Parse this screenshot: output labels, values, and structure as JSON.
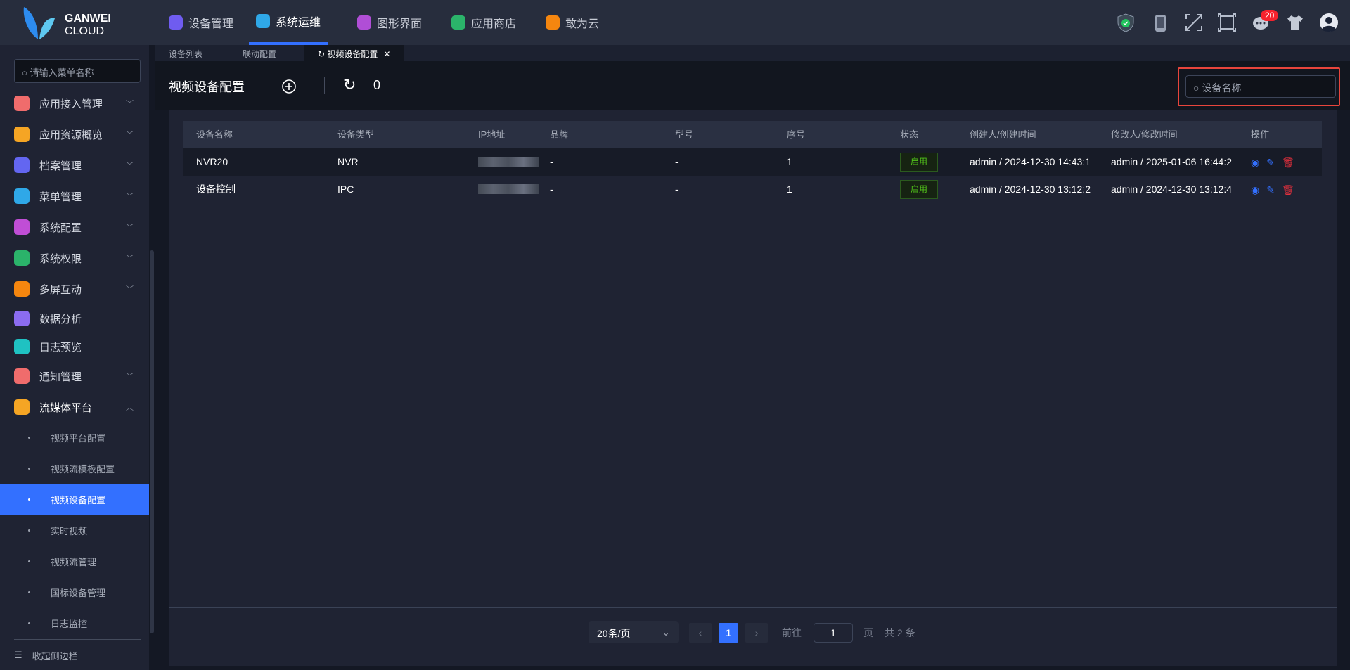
{
  "brand": {
    "line1": "GANWEI",
    "line2": "CLOUD"
  },
  "nav": [
    {
      "label": "设备管理",
      "color": "#6f5cf0"
    },
    {
      "label": "系统运维",
      "color": "#2fa8e8",
      "active": true
    },
    {
      "label": "图形界面",
      "color": "#b04ed6"
    },
    {
      "label": "应用商店",
      "color": "#2bb36a"
    },
    {
      "label": "敢为云",
      "color": "#f5860f"
    }
  ],
  "top_icons": {
    "badge": "20"
  },
  "sidebar": {
    "search_placeholder": "请输入菜单名称",
    "items": [
      {
        "label": "应用接入管理",
        "color": "#f06c6c"
      },
      {
        "label": "应用资源概览",
        "color": "#f5a524"
      },
      {
        "label": "档案管理",
        "color": "#6366f1"
      },
      {
        "label": "菜单管理",
        "color": "#2fa8e8"
      },
      {
        "label": "系统配置",
        "color": "#c04ed6"
      },
      {
        "label": "系统权限",
        "color": "#2bb36a"
      },
      {
        "label": "多屏互动",
        "color": "#f5860f"
      },
      {
        "label": "数据分析",
        "color": "#8b6cf0"
      },
      {
        "label": "日志预览",
        "color": "#1fc2c2"
      },
      {
        "label": "通知管理",
        "color": "#f06c6c"
      },
      {
        "label": "流媒体平台",
        "color": "#f5a524"
      }
    ],
    "sub": [
      "视频平台配置",
      "视频流模板配置",
      "视频设备配置",
      "实时视频",
      "视频流管理",
      "国标设备管理",
      "日志监控"
    ],
    "collapse": "收起侧边栏"
  },
  "tabs": [
    "设备列表",
    "联动配置",
    "视频设备配置"
  ],
  "toolbar": {
    "title": "视频设备配置",
    "count": "0",
    "search_placeholder": "设备名称"
  },
  "table": {
    "headers": [
      "设备名称",
      "设备类型",
      "IP地址",
      "品牌",
      "型号",
      "序号",
      "状态",
      "创建人/创建时间",
      "修改人/修改时间",
      "操作"
    ],
    "rows": [
      [
        "NVR20",
        "NVR",
        "",
        "-",
        "-",
        "1",
        "启用",
        "admin / 2024-12-30 14:43:1",
        "admin / 2025-01-06 16:44:2"
      ],
      [
        "设备控制",
        "IPC",
        "",
        "-",
        "-",
        "1",
        "启用",
        "admin / 2024-12-30 13:12:2",
        "admin / 2024-12-30 13:12:4"
      ]
    ]
  },
  "pagination": {
    "page_size": "20条/页",
    "current": "1",
    "goto_label": "前往",
    "goto_value": "1",
    "page_unit": "页",
    "total": "共 2 条"
  }
}
